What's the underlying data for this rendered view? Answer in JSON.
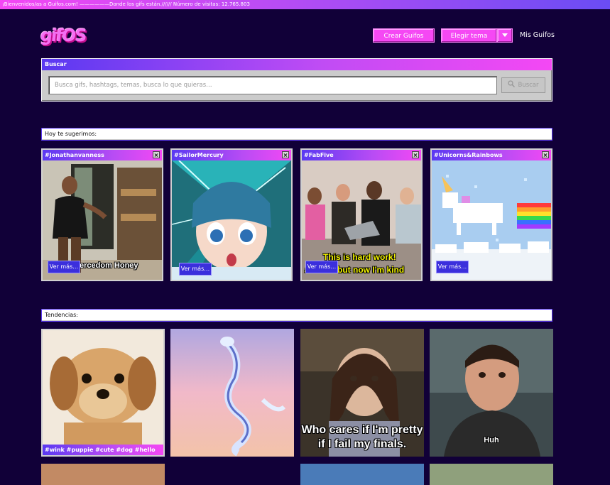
{
  "ticker": {
    "text": "¡Bienvenidos/as a Guifos.com! ——————Donde los gifs están.////// Número de visitas: 12.765.803"
  },
  "header": {
    "logo": "gifOS",
    "create_button": "Crear Guifos",
    "theme_button": "Elegir tema",
    "theme_dropdown_icon": "chevron-down-icon",
    "my_gifs_link": "Mis Guifos"
  },
  "search": {
    "title": "Buscar",
    "placeholder": "Busca gifs, hashtags, temas, busca lo que quieras…",
    "button_label": "Buscar",
    "button_icon": "search-icon"
  },
  "suggestions": {
    "title": "Hoy te sugerimos:",
    "cards": [
      {
        "tag": "#Jonathanvanness",
        "button": "Ver más…",
        "caption": "ercedom Honey"
      },
      {
        "tag": "#SailorMercury",
        "button": "Ver más…",
        "caption": ""
      },
      {
        "tag": "#FabFive",
        "button": "Ver más…",
        "caption_line1": "This is hard work!",
        "caption_line2": "a writer but now I'm kind"
      },
      {
        "tag": "#Unicorns&Rainbows",
        "button": "Ver más…",
        "caption": ""
      }
    ]
  },
  "trends": {
    "title": "Tendencias:",
    "items": [
      {
        "tags": "#wink #puppie #cute #dog #hello #hi"
      },
      {
        "tags": ""
      },
      {
        "caption_line1": "Who cares if I'm pretty",
        "caption_line2": "if I fail my finals."
      },
      {
        "caption": "Huh"
      }
    ]
  },
  "colors": {
    "background": "#110038",
    "accent_pink": "#f548f4",
    "accent_blue": "#5a39f2",
    "panel_gray": "#cbcbcb"
  }
}
